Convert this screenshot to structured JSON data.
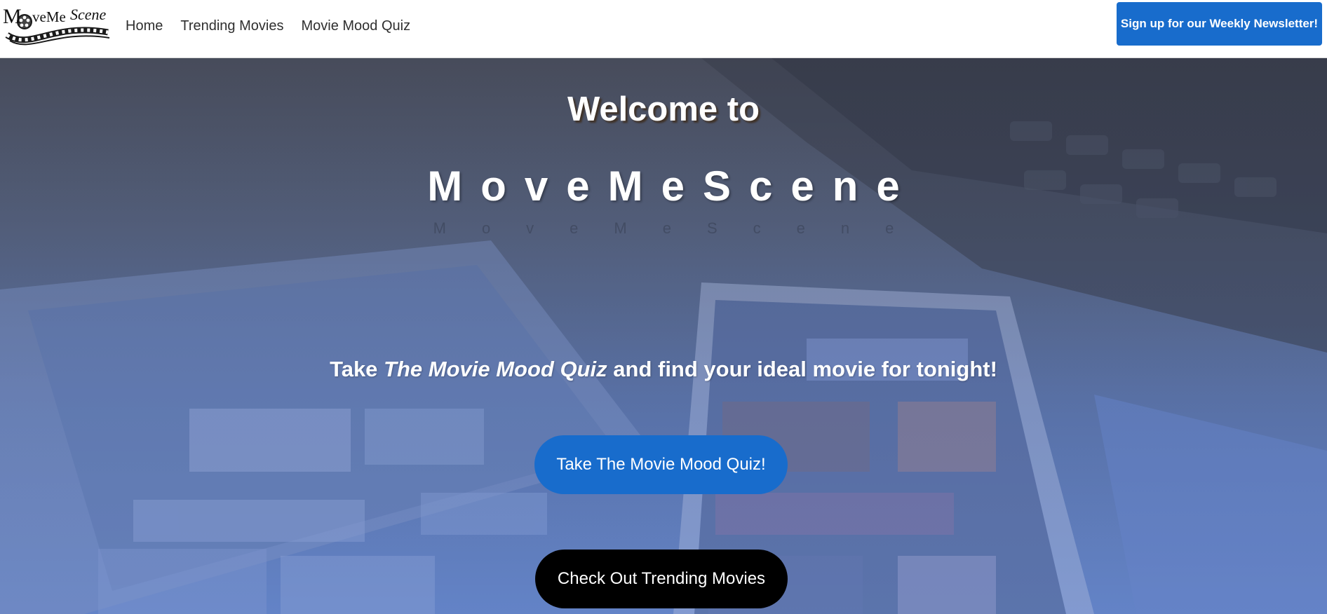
{
  "brand": {
    "logo_text_mo": "M",
    "logo_text_ve": "veMe",
    "logo_text_scene": "Scene",
    "logo_alt": "MoveMeScene logo"
  },
  "nav": {
    "items": [
      {
        "label": "Home"
      },
      {
        "label": "Trending Movies"
      },
      {
        "label": "Movie Mood Quiz"
      }
    ],
    "newsletter_label": "Sign up for our Weekly Newsletter!"
  },
  "hero": {
    "welcome": "Welcome to",
    "title": "MoveMeScene",
    "title_reflection": "MoveMeScene",
    "tagline_prefix": "Take ",
    "tagline_emphasis": "The Movie Mood Quiz",
    "tagline_suffix": " and find your ideal movie for tonight!",
    "quiz_button": "Take The Movie Mood Quiz!",
    "trending_button": "Check Out Trending Movies"
  },
  "colors": {
    "primary": "#186ccc",
    "dark_button": "#000000",
    "nav_text": "#2f2f2f"
  }
}
